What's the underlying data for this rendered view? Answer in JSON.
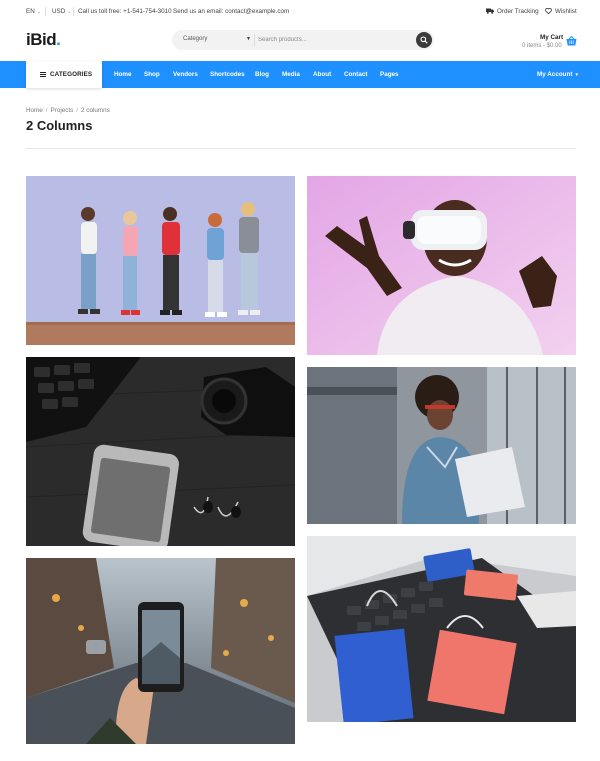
{
  "topbar": {
    "language": "EN",
    "currency": "USD",
    "phone": "Call us toll free: +1-541-754-3010",
    "email": "Send us an email: contact@example.com",
    "order_tracking": "Order Tracking",
    "wishlist": "Wishlist"
  },
  "header": {
    "logo_text": "iBid",
    "logo_dot": ".",
    "search": {
      "category": "Category",
      "placeholder": "Search products..."
    },
    "cart": {
      "title": "My Cart",
      "summary": "0 items - $0.00"
    }
  },
  "nav": {
    "categories_label": "CATEGORIES",
    "items": [
      "Home",
      "Shop",
      "Vendors",
      "Shortcodes",
      "Blog",
      "Media",
      "About",
      "Contact",
      "Pages"
    ],
    "account": "My Account"
  },
  "breadcrumb": {
    "items": [
      "Home",
      "Projects",
      "2 columns"
    ],
    "separator": "/"
  },
  "page": {
    "title": "2 Columns"
  },
  "gallery": {
    "tiles": [
      {
        "subject": "people-phones-wall"
      },
      {
        "subject": "vr-headset-man"
      },
      {
        "subject": "phone-camera-desk"
      },
      {
        "subject": "woman-laptop"
      },
      {
        "subject": "phone-city-street"
      },
      {
        "subject": "shopping-bags-laptop"
      }
    ]
  },
  "colors": {
    "accent": "#1e90ff",
    "text": "#222222"
  }
}
